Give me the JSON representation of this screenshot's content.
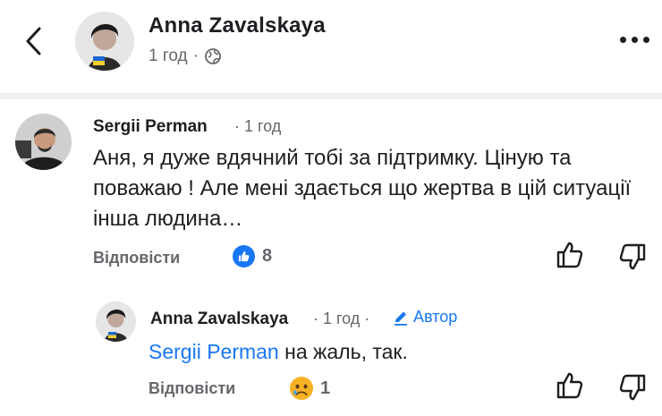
{
  "header": {
    "author": "Anna Zavalskaya",
    "time": "1 год",
    "separator": "·",
    "privacy_icon": "globe-icon",
    "back_icon": "chevron-left-icon",
    "more_icon": "more-dots-icon"
  },
  "comments": [
    {
      "author": "Sergii Perman",
      "time": "· 1 год",
      "text": "Аня, я дуже вдячний тобі за підтримку. Ціную та поважаю ! Але мені здається що жертва в цій ситуації інша людина…",
      "reply_label": "Відповісти",
      "reaction_icon": "like-icon",
      "reaction_count": "8"
    },
    {
      "author": "Anna Zavalskaya",
      "time": "· 1 год ·",
      "author_badge": "Автор",
      "mention": "Sergii Perman",
      "text": " на жаль, так.",
      "reply_label": "Відповісти",
      "reaction_icon": "sad-face-icon",
      "reaction_count": "1"
    }
  ],
  "colors": {
    "accent": "#1877f2",
    "text": "#1c1e21",
    "secondary": "#65676b",
    "divider": "#eef0f3",
    "sad_emoji": "#f7b125",
    "ukraine_blue": "#1f66d1",
    "ukraine_yellow": "#f5cf2a"
  }
}
